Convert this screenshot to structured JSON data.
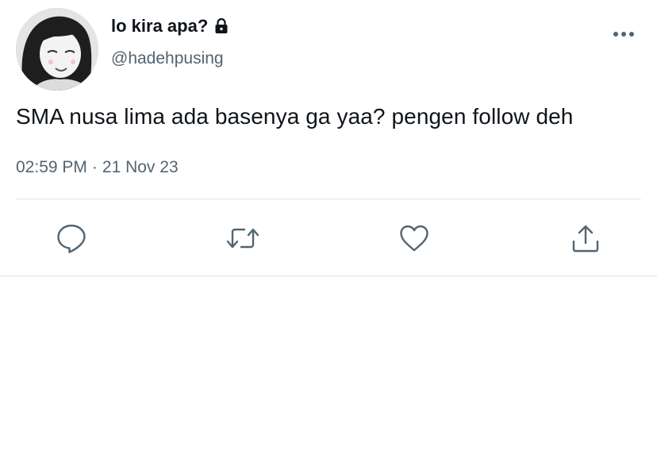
{
  "user": {
    "display_name": "lo kira apa?",
    "handle": "@hadehpusing",
    "protected_icon": "lock-icon",
    "avatar": "profile-photo"
  },
  "tweet": {
    "text": "SMA nusa lima ada basenya ga yaa? pengen follow deh",
    "time": "02:59 PM",
    "separator": "·",
    "date": "21 Nov 23"
  },
  "actions": {
    "more": "more-dots-icon",
    "reply": "reply-icon",
    "retweet": "retweet-icon",
    "like": "heart-icon",
    "share": "share-icon"
  },
  "colors": {
    "text_primary": "#0f1419",
    "text_secondary": "#536471",
    "icon": "#536471",
    "divider": "#e6e6e6"
  }
}
